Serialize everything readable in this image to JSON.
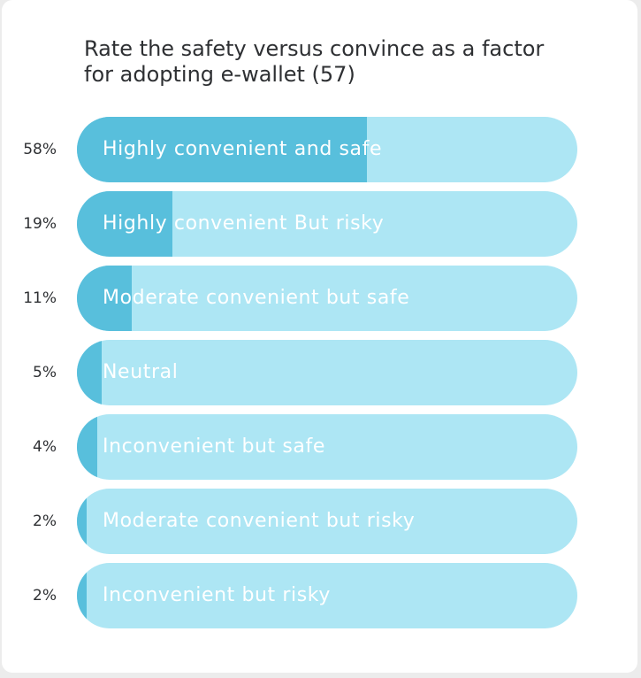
{
  "chart_data": {
    "type": "bar",
    "orientation": "horizontal",
    "title": "Rate the safety versus convince as a factor for adopting e-wallet (57)",
    "categories": [
      "Highly convenient and safe",
      "Highly convenient But risky",
      "Moderate convenient but safe",
      "Neutral",
      "Inconvenient but safe",
      "Moderate convenient but risky",
      "Inconvenient but risky"
    ],
    "values": [
      58,
      19,
      11,
      5,
      4,
      2,
      2
    ],
    "value_labels": [
      "58%",
      "19%",
      "11%",
      "5%",
      "4%",
      "2%",
      "2%"
    ],
    "xlim": [
      0,
      100
    ],
    "grid": false,
    "colors": {
      "fill": "#58bfdc",
      "track": "#ade6f4",
      "label_text": "#ffffff"
    }
  }
}
